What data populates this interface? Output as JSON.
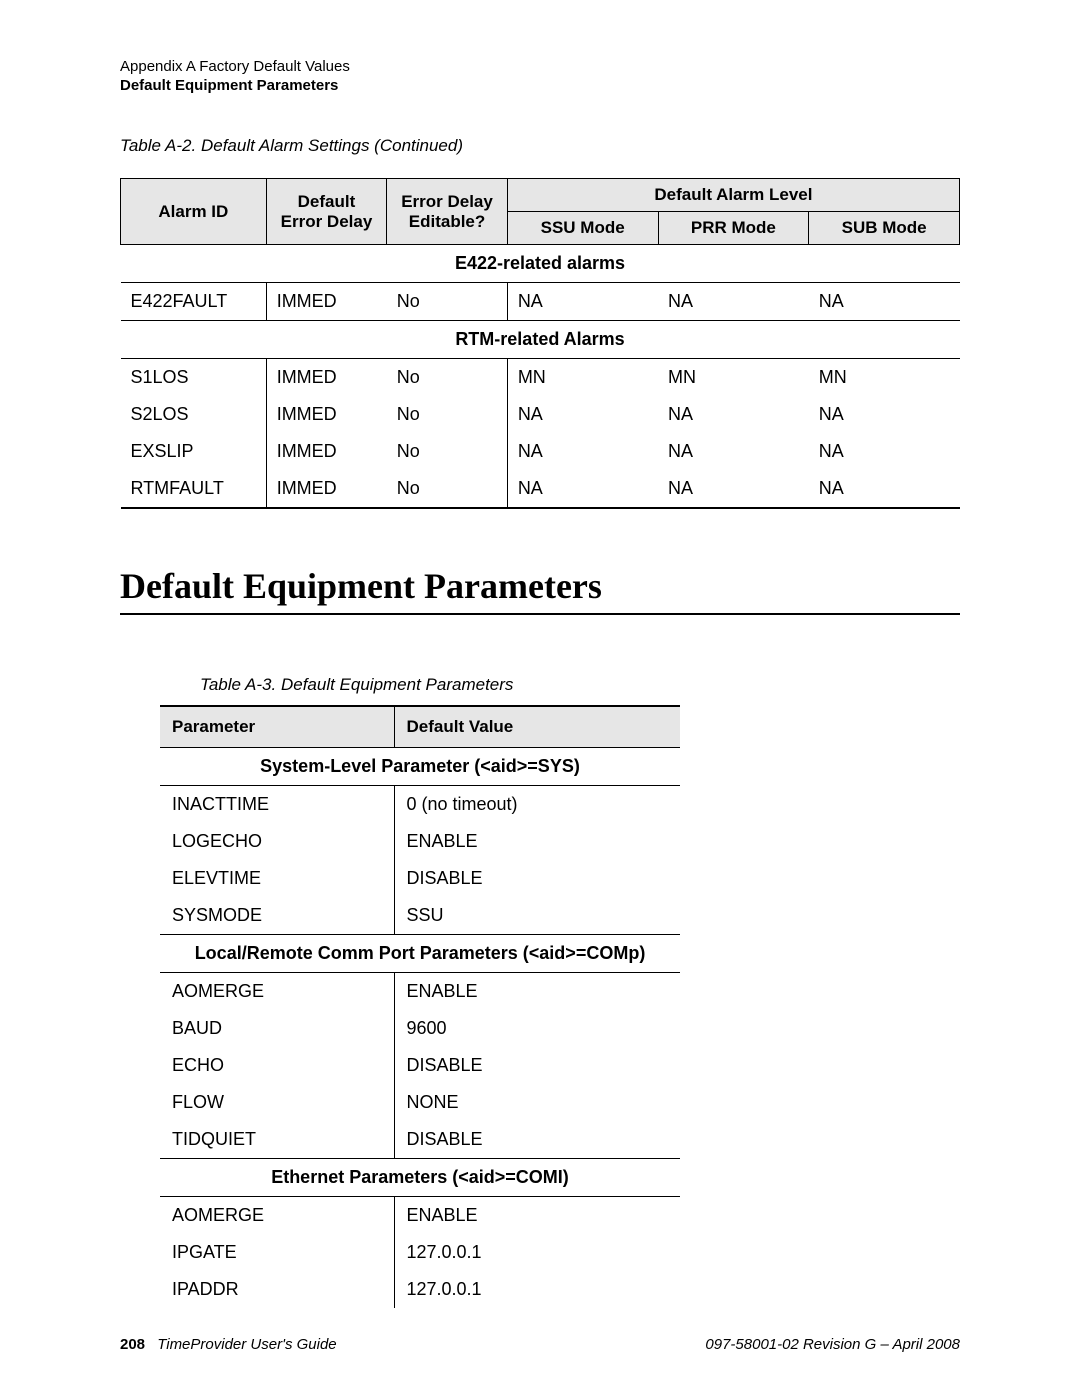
{
  "header": {
    "line1": "Appendix A Factory Default Values",
    "line2": "Default Equipment Parameters"
  },
  "table_a2": {
    "caption": "Table A-2. Default Alarm Settings (Continued)",
    "head": {
      "alarm_id": "Alarm ID",
      "default_error_delay": "Default Error Delay",
      "error_delay_editable": "Error Delay Editable?",
      "default_alarm_level": "Default Alarm Level",
      "ssu": "SSU Mode",
      "prr": "PRR Mode",
      "sub": "SUB Mode"
    },
    "sections": [
      {
        "title": "E422-related alarms",
        "rows": [
          {
            "id": "E422FAULT",
            "delay": "IMMED",
            "editable": "No",
            "ssu": "NA",
            "prr": "NA",
            "sub": "NA"
          }
        ]
      },
      {
        "title": "RTM-related Alarms",
        "rows": [
          {
            "id": "S1LOS",
            "delay": "IMMED",
            "editable": "No",
            "ssu": "MN",
            "prr": "MN",
            "sub": "MN"
          },
          {
            "id": "S2LOS",
            "delay": "IMMED",
            "editable": "No",
            "ssu": "NA",
            "prr": "NA",
            "sub": "NA"
          },
          {
            "id": "EXSLIP",
            "delay": "IMMED",
            "editable": "No",
            "ssu": "NA",
            "prr": "NA",
            "sub": "NA"
          },
          {
            "id": "RTMFAULT",
            "delay": "IMMED",
            "editable": "No",
            "ssu": "NA",
            "prr": "NA",
            "sub": "NA"
          }
        ]
      }
    ]
  },
  "section_heading": "Default Equipment Parameters",
  "table_a3": {
    "caption": "Table A-3.  Default Equipment Parameters",
    "head": {
      "parameter": "Parameter",
      "default_value": "Default Value"
    },
    "sections": [
      {
        "title": "System-Level Parameter (<aid>=SYS)",
        "rows": [
          {
            "p": "INACTTIME",
            "v": "0 (no timeout)"
          },
          {
            "p": "LOGECHO",
            "v": "ENABLE"
          },
          {
            "p": "ELEVTIME",
            "v": "DISABLE"
          },
          {
            "p": "SYSMODE",
            "v": "SSU"
          }
        ]
      },
      {
        "title": "Local/Remote Comm Port Parameters (<aid>=COMp)",
        "rows": [
          {
            "p": "AOMERGE",
            "v": "ENABLE"
          },
          {
            "p": "BAUD",
            "v": "9600"
          },
          {
            "p": "ECHO",
            "v": "DISABLE"
          },
          {
            "p": "FLOW",
            "v": "NONE"
          },
          {
            "p": "TIDQUIET",
            "v": "DISABLE"
          }
        ]
      },
      {
        "title": "Ethernet Parameters (<aid>=COMI)",
        "rows": [
          {
            "p": "AOMERGE",
            "v": "ENABLE"
          },
          {
            "p": "IPGATE",
            "v": "127.0.0.1"
          },
          {
            "p": "IPADDR",
            "v": "127.0.0.1"
          }
        ]
      }
    ]
  },
  "footer": {
    "page_num": "208",
    "book": "TimeProvider User's Guide",
    "rev": "097-58001-02 Revision G – April 2008"
  }
}
